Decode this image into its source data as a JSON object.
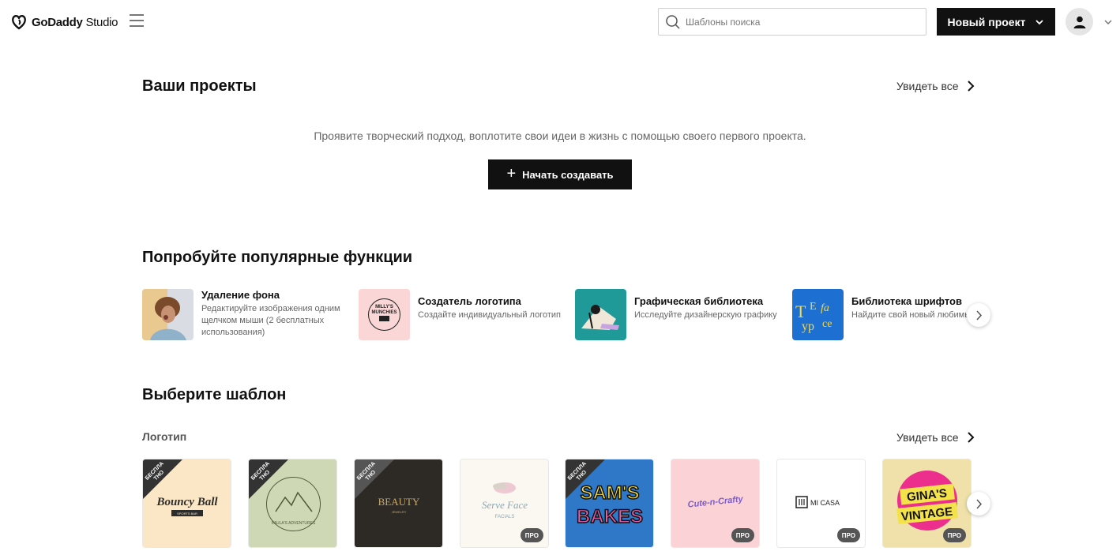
{
  "header": {
    "logo_brand": "GoDaddy",
    "logo_product": "Studio",
    "search_placeholder": "Шаблоны поиска",
    "new_project_label": "Новый проект"
  },
  "projects": {
    "title": "Ваши проекты",
    "see_all": "Увидеть все",
    "empty_message": "Проявите творческий подход, воплотите свои идеи в жизнь с помощью своего первого проекта.",
    "start_label": "Начать создавать"
  },
  "features": {
    "title": "Попробуйте популярные функции",
    "items": [
      {
        "title": "Удаление фона",
        "desc": "Редактируйте изображения одним щелчком мыши (2 бесплатных использования)"
      },
      {
        "title": "Создатель логотипа",
        "desc": "Создайте индивидуальный логотип"
      },
      {
        "title": "Графическая библиотека",
        "desc": "Исследуйте дизайнерскую графику"
      },
      {
        "title": "Библиотека шрифтов",
        "desc": "Найдите свой новый любимый шрифт"
      }
    ]
  },
  "templates": {
    "title": "Выберите шаблон",
    "category": "Логотип",
    "see_all": "Увидеть все",
    "free_badge": "БЕСПЛА ТНО",
    "pro_badge": "ПРО",
    "items": [
      {
        "text": "Bouncy Ball",
        "subtext": "SPORTS BAR",
        "bg": "#fbe7c6",
        "badge": "free"
      },
      {
        "text": "PAULA'S ADVENTURES",
        "subtext": "",
        "bg": "#cfd8b5",
        "badge": "free"
      },
      {
        "text": "BEAUTY",
        "subtext": "JEWELRY",
        "bg": "#2d2a26",
        "badge": "free"
      },
      {
        "text": "Serve Face",
        "subtext": "FACIALS",
        "bg": "#fbf8f2",
        "badge": "pro"
      },
      {
        "text": "SAM'S",
        "subtext": "BAKES",
        "bg": "#2f78c7",
        "badge": "free"
      },
      {
        "text": "Cute-n-Crafty",
        "subtext": "",
        "bg": "#fbd3d6",
        "badge": "pro"
      },
      {
        "text": "MI CASA",
        "subtext": "",
        "bg": "#ffffff",
        "badge": "pro"
      },
      {
        "text": "GINA'S",
        "subtext": "VINTAGE",
        "bg": "#efe1a9",
        "badge": "pro"
      }
    ]
  }
}
